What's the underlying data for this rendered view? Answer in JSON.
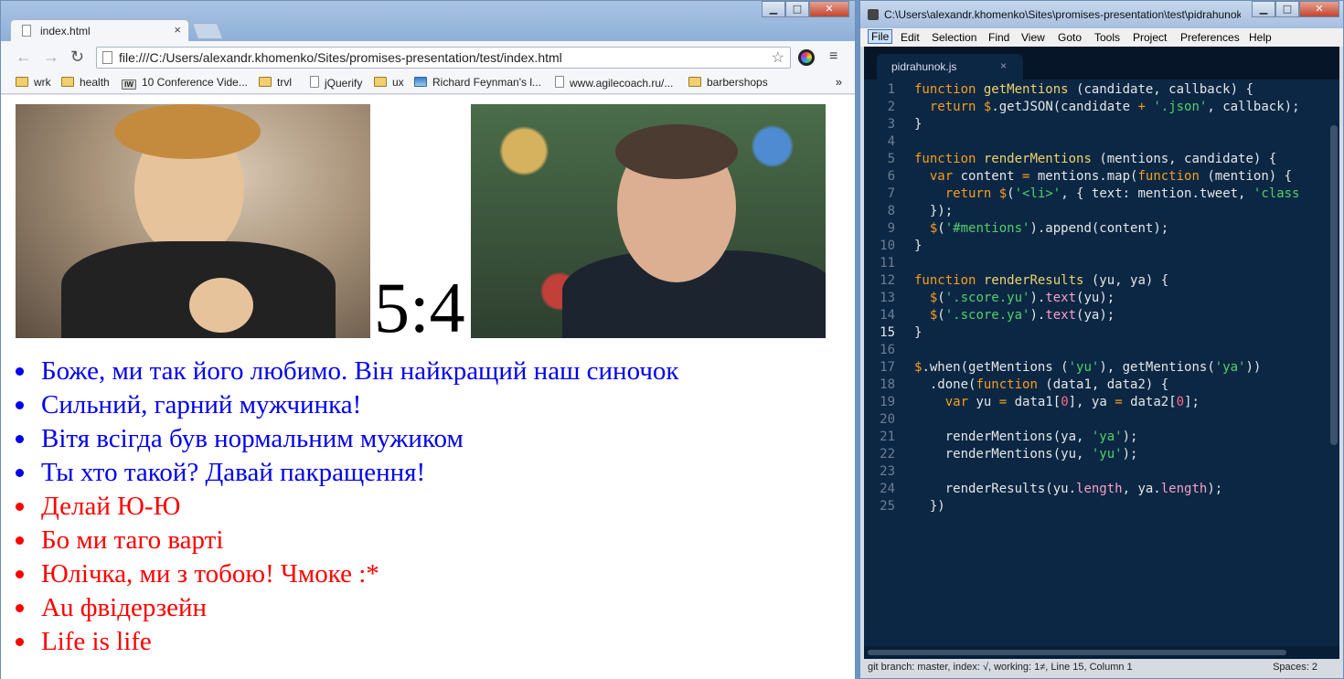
{
  "browser": {
    "tab_title": "index.html",
    "tab_close": "×",
    "window_buttons": {
      "minimize": "▁",
      "maximize": "□",
      "close": "✕"
    },
    "nav": {
      "back": "←",
      "forward": "→",
      "reload": "↻"
    },
    "url": "file:///C:/Users/alexandr.khomenko/Sites/promises-presentation/test/index.html",
    "star": "☆",
    "menu": "≡",
    "bookmarks": [
      {
        "label": "wrk",
        "icon": "folder-icon"
      },
      {
        "label": "health",
        "icon": "folder-icon"
      },
      {
        "label": "10 Conference Vide...",
        "icon": "iw-icon"
      },
      {
        "label": "trvl",
        "icon": "folder-icon"
      },
      {
        "label": "jQuerify",
        "icon": "page-icon"
      },
      {
        "label": "ux",
        "icon": "folder-icon"
      },
      {
        "label": "Richard Feynman's l...",
        "icon": "image-icon"
      },
      {
        "label": "www.agilecoach.ru/...",
        "icon": "page-icon"
      },
      {
        "label": "barbershops",
        "icon": "folder-icon"
      }
    ],
    "bookmarks_more": "»",
    "iw_text": "IW"
  },
  "page": {
    "score_yu": "5",
    "score_sep": ":",
    "score_ya": "4",
    "mentions": [
      {
        "text": "Боже, ми так його любимо. Він найкращий наш синочок",
        "class": "yu"
      },
      {
        "text": "Сильний, гарний мужчинка!",
        "class": "yu"
      },
      {
        "text": "Вітя всігда був нормальним мужиком",
        "class": "yu"
      },
      {
        "text": "Ты хто такой? Давай пакращення!",
        "class": "yu"
      },
      {
        "text": "Делай Ю-Ю",
        "class": "ya"
      },
      {
        "text": "Бо ми таго варті",
        "class": "ya"
      },
      {
        "text": "Юлічка, ми з тобою! Чмоке :*",
        "class": "ya"
      },
      {
        "text": "Au фвідерзейн",
        "class": "ya"
      },
      {
        "text": "Life is life",
        "class": "ya"
      }
    ],
    "colors": {
      "yu": "#0000ee",
      "ya": "#ff0000"
    }
  },
  "editor": {
    "window_title": "C:\\Users\\alexandr.khomenko\\Sites\\promises-presentation\\test\\pidrahunok.js",
    "menu": [
      "File",
      "Edit",
      "Selection",
      "Find",
      "View",
      "Goto",
      "Tools",
      "Project",
      "Preferences",
      "Help"
    ],
    "file_tab": "pidrahunok.js",
    "file_tab_close": "×",
    "current_line": 15,
    "code_lines": [
      "function getMentions (candidate, callback) {",
      "  return $.getJSON(candidate + '.json', callback);",
      "}",
      "",
      "function renderMentions (mentions, candidate) {",
      "  var content = mentions.map(function (mention) {",
      "    return $('<li>', { text: mention.tweet, 'class",
      "  });",
      "  $('#mentions').append(content);",
      "}",
      "",
      "function renderResults (yu, ya) {",
      "  $('.score.yu').text(yu);",
      "  $('.score.ya').text(ya);",
      "}",
      "",
      "$.when(getMentions ('yu'), getMentions('ya'))",
      "  .done(function (data1, data2) {",
      "    var yu = data1[0], ya = data2[0];",
      "",
      "    renderMentions(ya, 'ya');",
      "    renderMentions(yu, 'yu');",
      "",
      "    renderResults(yu.length, ya.length);",
      "  })"
    ],
    "status_left": "git branch: master, index: √, working: 1≠, Line 15, Column 1",
    "status_right": "Spaces: 2"
  }
}
